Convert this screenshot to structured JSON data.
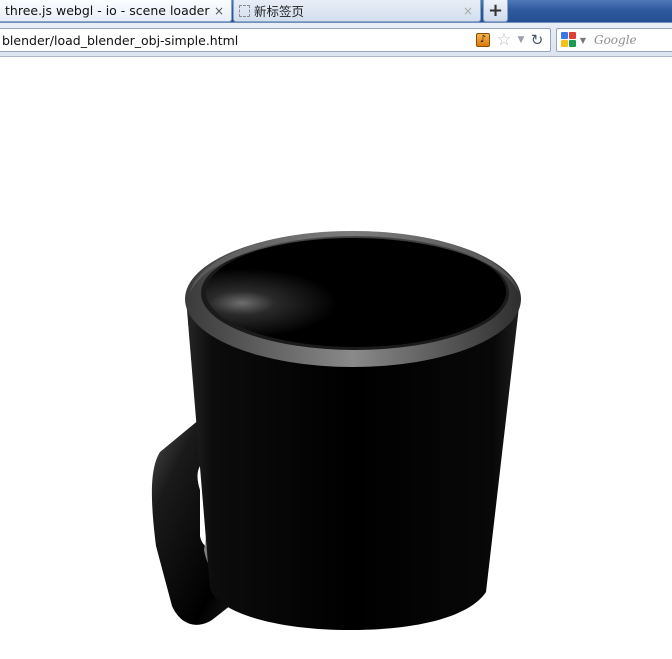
{
  "tabs": [
    {
      "title": "three.js webgl - io - scene loader [ble...",
      "close": "×",
      "active": true
    },
    {
      "title": "新标签页",
      "close": "×",
      "active": false
    }
  ],
  "new_tab": {
    "label": "+"
  },
  "address_bar": {
    "url": "blender/load_blender_obj-simple.html",
    "star": "☆",
    "dropdown": "▼",
    "reload": "↻"
  },
  "search_bar": {
    "placeholder": "Google",
    "dropdown": "▼"
  },
  "colors": {
    "tab_strip": "#2f5a9d",
    "page_background": "#ffffff",
    "model": "#000000",
    "google_blue": "#3b78e7",
    "google_red": "#de3e35",
    "google_yellow": "#f7c01b",
    "google_green": "#189c52"
  },
  "icons": {
    "bookmark": "star-icon",
    "reload": "reload-icon",
    "search_engine": "google-icon",
    "addon": "music-icon"
  }
}
